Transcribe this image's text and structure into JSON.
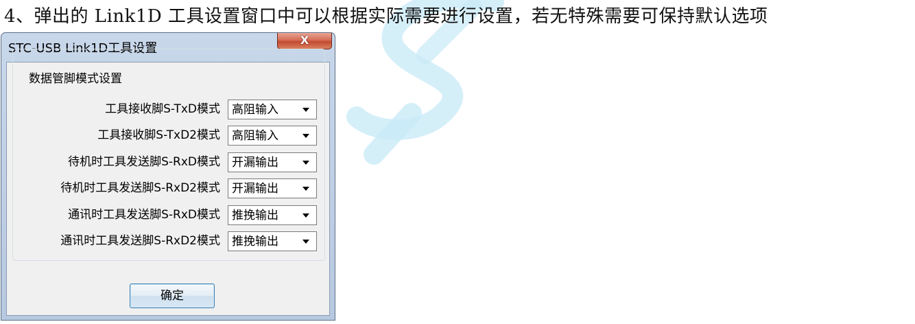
{
  "instruction": "4、弹出的 Link1D 工具设置窗口中可以根据实际需要进行设置，若无特殊需要可保持默认选项",
  "watermark": {
    "text": "STC",
    "color": "#bfe6f5"
  },
  "dialog": {
    "title": "STC-USB Link1D工具设置",
    "close_glyph": "X",
    "group_title": "数据管脚模式设置",
    "rows": [
      {
        "label": "工具接收脚S-TxD模式",
        "value": "高阻输入"
      },
      {
        "label": "工具接收脚S-TxD2模式",
        "value": "高阻输入"
      },
      {
        "label": "待机时工具发送脚S-RxD模式",
        "value": "开漏输出"
      },
      {
        "label": "待机时工具发送脚S-RxD2模式",
        "value": "开漏输出"
      },
      {
        "label": "通讯时工具发送脚S-RxD模式",
        "value": "推挽输出"
      },
      {
        "label": "通讯时工具发送脚S-RxD2模式",
        "value": "推挽输出"
      }
    ],
    "ok_label": "确定"
  }
}
